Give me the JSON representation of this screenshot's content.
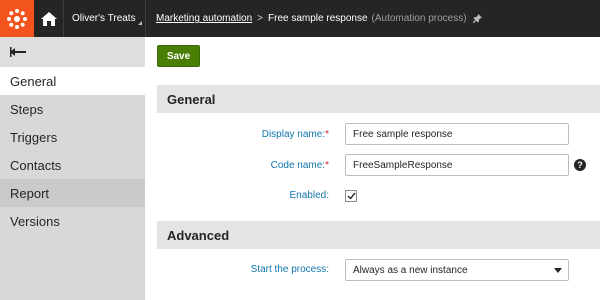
{
  "header": {
    "site_name": "Oliver's Treats",
    "breadcrumb_link": "Marketing automation",
    "breadcrumb_separator": ">",
    "page_name": "Free sample response",
    "page_type": "(Automation process)"
  },
  "sidebar": {
    "items": [
      {
        "label": "General"
      },
      {
        "label": "Steps"
      },
      {
        "label": "Triggers"
      },
      {
        "label": "Contacts"
      },
      {
        "label": "Report"
      },
      {
        "label": "Versions"
      }
    ]
  },
  "toolbar": {
    "save_label": "Save"
  },
  "general": {
    "title": "General",
    "display_name_label": "Display name:",
    "display_name_value": "Free sample response",
    "code_name_label": "Code name:",
    "code_name_value": "FreeSampleResponse",
    "required_mark": "*",
    "help_glyph": "?",
    "enabled_label": "Enabled:",
    "enabled_checked": true
  },
  "advanced": {
    "title": "Advanced",
    "start_label": "Start the process:",
    "start_value": "Always as a new instance"
  },
  "colors": {
    "topbar": "#262524",
    "brand": "#f3541e",
    "save_button": "#497d04",
    "label_blue": "#1175ae",
    "required_red": "#c7252d"
  },
  "icons": [
    "kentico-logo-icon",
    "home-icon",
    "pin-icon",
    "back-arrow-icon",
    "help-icon",
    "checkmark-icon",
    "chevron-down-icon"
  ]
}
